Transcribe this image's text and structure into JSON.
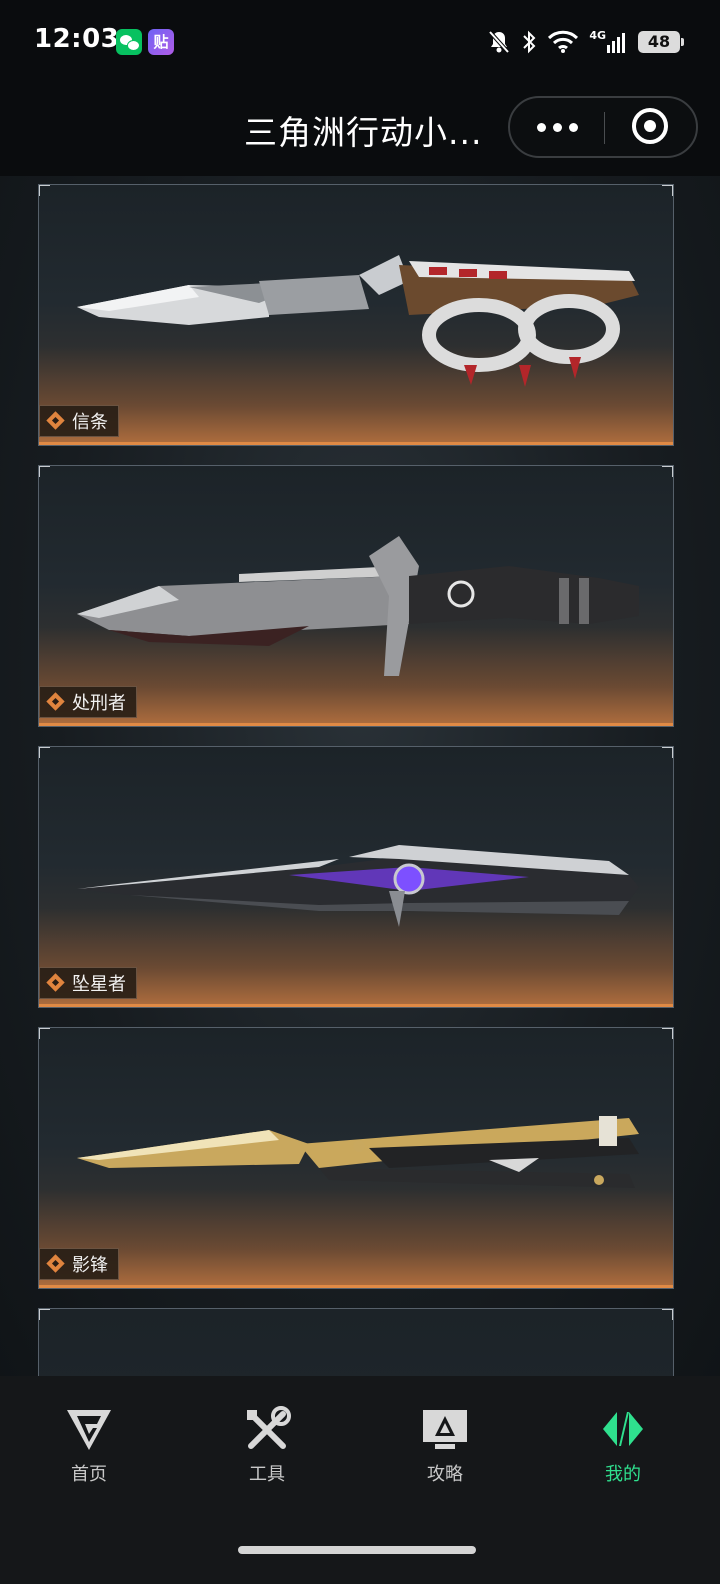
{
  "status_bar": {
    "time": "12:03",
    "network": "4G",
    "battery": "48",
    "icons": [
      "wechat-icon",
      "tie-app-icon",
      "mute-bell-icon",
      "bluetooth-icon",
      "wifi-icon",
      "signal-icon",
      "battery-icon"
    ]
  },
  "app_badges": {
    "tie_label": "贴"
  },
  "nav": {
    "title": "三角洲行动小..."
  },
  "cards": [
    {
      "name": "信条"
    },
    {
      "name": "处刑者"
    },
    {
      "name": "坠星者"
    },
    {
      "name": "影锋"
    }
  ],
  "tabs": [
    {
      "label": "首页",
      "icon": "home-logo-icon"
    },
    {
      "label": "工具",
      "icon": "tools-icon"
    },
    {
      "label": "攻略",
      "icon": "guide-icon"
    },
    {
      "label": "我的",
      "icon": "profile-logo-icon",
      "active": true
    }
  ],
  "colors": {
    "accent": "#2fe08e",
    "card_glow": "#b06e3e",
    "tag_orange": "#e0843e"
  }
}
